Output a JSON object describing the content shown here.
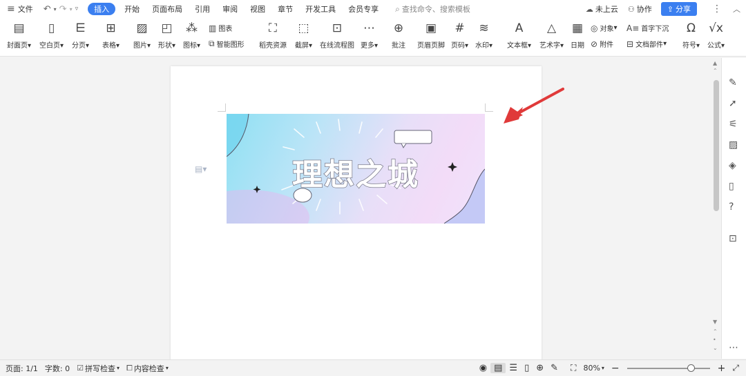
{
  "menu": {
    "file": "文件",
    "tabs": [
      "插入",
      "开始",
      "页面布局",
      "引用",
      "审阅",
      "视图",
      "章节",
      "开发工具",
      "会员专享"
    ],
    "active_tab": "插入",
    "search_placeholder": "查找命令、搜索模板",
    "cloud": "未上云",
    "collab": "协作",
    "share": "分享"
  },
  "ribbon": {
    "cover": "封面页",
    "blank": "空白页",
    "pagebreak": "分页",
    "table": "表格",
    "picture": "图片",
    "shape": "形状",
    "icons": "图标",
    "chart": "图表",
    "smartart": "智能图形",
    "shell": "稻壳资源",
    "screenshot": "截屏",
    "flowchart": "在线流程图",
    "more": "更多",
    "comment": "批注",
    "headerfooter": "页眉页脚",
    "pagenum": "页码",
    "watermark": "水印",
    "textbox": "文本框",
    "wordart": "艺术字",
    "date": "日期",
    "object": "对象",
    "dropcap": "首字下沉",
    "attach": "附件",
    "docpart": "文档部件",
    "symbol": "符号",
    "formula": "公式"
  },
  "document": {
    "banner_title": "理想之城"
  },
  "status": {
    "page": "页面: 1/1",
    "words": "字数: 0",
    "spell": "拼写检查",
    "content": "内容检查",
    "zoom": "80%",
    "zoom_level": 0.8
  },
  "colors": {
    "accent": "#3b7ff0",
    "arrow": "#e03a3a"
  }
}
